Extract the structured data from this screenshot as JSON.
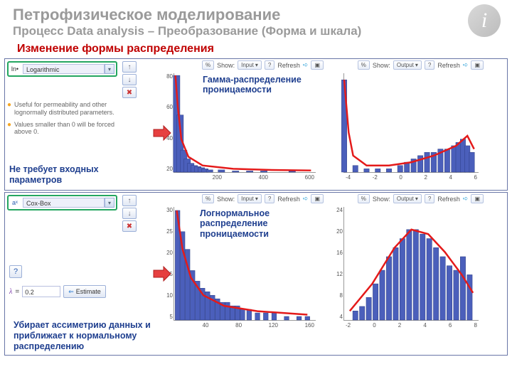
{
  "title": "Петрофизическое моделирование",
  "subtitle": "Процесс Data analysis – Преобразование (Форма и шкала)",
  "headline": "Изменение формы распределения",
  "logo_glyph": "i",
  "section1": {
    "dropdown_value": "Logarithmic",
    "bullets": [
      "Useful for permeability and other lognormally distributed parameters.",
      "Values smaller than 0 will be forced above 0."
    ],
    "caption": "Не требует входных параметров",
    "chart_annot": "Гамма-распределение проницаемости",
    "chart_in": {
      "toolbar_show": "Show:",
      "toolbar_sel": "Input",
      "refresh": "Refresh",
      "yticks": [
        "80",
        "60",
        "40",
        "20"
      ],
      "xticks": [
        "200",
        "400",
        "600"
      ]
    },
    "chart_out": {
      "toolbar_show": "Show:",
      "toolbar_sel": "Output",
      "refresh": "Refresh",
      "yticks": [
        "",
        "",
        "",
        ""
      ],
      "xticks": [
        "-4",
        "-2",
        "0",
        "2",
        "4",
        "6"
      ]
    }
  },
  "section2": {
    "dropdown_value": "Cox-Box",
    "lambda_label": "λ",
    "lambda_eq": "=",
    "lambda_val": "0.2",
    "estimate": "Estimate",
    "caption": "Убирает ассиметрию данных и приближает к нормальному распределению",
    "chart_annot": "Логнормальное распределение проницаемости",
    "chart_in": {
      "toolbar_show": "Show:",
      "toolbar_sel": "Input",
      "refresh": "Refresh",
      "yticks": [
        "30",
        "25",
        "20",
        "15",
        "10",
        "5"
      ],
      "xticks": [
        "40",
        "80",
        "120",
        "160"
      ]
    },
    "chart_out": {
      "toolbar_show": "Show:",
      "toolbar_sel": "Output",
      "refresh": "Refresh",
      "yticks": [
        "24",
        "20",
        "16",
        "12",
        "8",
        "4"
      ],
      "xticks": [
        "-2",
        "0",
        "2",
        "4",
        "6",
        "8"
      ]
    }
  },
  "chart_data": [
    {
      "type": "bar",
      "name": "gamma-input",
      "xlabel": "",
      "ylabel": "",
      "xlim": [
        0,
        600
      ],
      "ylim": [
        0,
        90
      ],
      "bars": [
        [
          10,
          88
        ],
        [
          25,
          52
        ],
        [
          40,
          20
        ],
        [
          55,
          12
        ],
        [
          70,
          8
        ],
        [
          85,
          6
        ],
        [
          100,
          5
        ],
        [
          115,
          4
        ],
        [
          130,
          3
        ],
        [
          150,
          2
        ],
        [
          200,
          2
        ],
        [
          260,
          1
        ],
        [
          320,
          1
        ],
        [
          380,
          1
        ],
        [
          500,
          1
        ]
      ],
      "curve": [
        [
          5,
          88
        ],
        [
          15,
          60
        ],
        [
          30,
          30
        ],
        [
          60,
          14
        ],
        [
          120,
          6
        ],
        [
          250,
          3
        ],
        [
          400,
          2
        ],
        [
          580,
          1.5
        ]
      ]
    },
    {
      "type": "bar",
      "name": "gamma-output",
      "xlabel": "",
      "ylabel": "",
      "xlim": [
        -5,
        7
      ],
      "ylim": [
        0,
        30
      ],
      "bars": [
        [
          -5,
          28
        ],
        [
          -4,
          2
        ],
        [
          -3,
          1
        ],
        [
          -2,
          1
        ],
        [
          -1,
          1
        ],
        [
          0,
          2
        ],
        [
          0.6,
          3
        ],
        [
          1.2,
          4
        ],
        [
          1.8,
          5
        ],
        [
          2.4,
          6
        ],
        [
          3.0,
          6
        ],
        [
          3.6,
          7
        ],
        [
          4.2,
          7
        ],
        [
          4.8,
          8
        ],
        [
          5.2,
          9
        ],
        [
          5.6,
          10
        ],
        [
          6.0,
          8
        ],
        [
          6.4,
          6
        ]
      ],
      "curve": [
        [
          -5,
          28
        ],
        [
          -4.6,
          12
        ],
        [
          -4.2,
          5
        ],
        [
          -3.0,
          2
        ],
        [
          -1.0,
          2
        ],
        [
          1.0,
          3
        ],
        [
          3.0,
          5
        ],
        [
          5.0,
          8
        ],
        [
          6.0,
          11
        ],
        [
          6.6,
          7
        ]
      ]
    },
    {
      "type": "bar",
      "name": "lognorm-input",
      "xlabel": "",
      "ylabel": "",
      "xlim": [
        0,
        170
      ],
      "ylim": [
        0,
        32
      ],
      "bars": [
        [
          4,
          31
        ],
        [
          10,
          25
        ],
        [
          16,
          20
        ],
        [
          22,
          14
        ],
        [
          28,
          11
        ],
        [
          34,
          9
        ],
        [
          40,
          8
        ],
        [
          46,
          7
        ],
        [
          52,
          6
        ],
        [
          58,
          5
        ],
        [
          64,
          5
        ],
        [
          70,
          4
        ],
        [
          76,
          4
        ],
        [
          82,
          3
        ],
        [
          90,
          3
        ],
        [
          100,
          2
        ],
        [
          110,
          2
        ],
        [
          120,
          2
        ],
        [
          135,
          1
        ],
        [
          150,
          1
        ],
        [
          160,
          1
        ]
      ],
      "curve": [
        [
          3,
          31
        ],
        [
          10,
          20
        ],
        [
          20,
          12
        ],
        [
          35,
          7
        ],
        [
          60,
          4
        ],
        [
          100,
          2.5
        ],
        [
          160,
          1.5
        ]
      ]
    },
    {
      "type": "bar",
      "name": "lognorm-output",
      "xlabel": "",
      "ylabel": "",
      "xlim": [
        -3,
        9
      ],
      "ylim": [
        0,
        25
      ],
      "bars": [
        [
          -2,
          2
        ],
        [
          -1.4,
          3
        ],
        [
          -0.8,
          5
        ],
        [
          -0.2,
          8
        ],
        [
          0.4,
          11
        ],
        [
          1.0,
          14
        ],
        [
          1.6,
          16
        ],
        [
          2.2,
          18
        ],
        [
          2.8,
          20
        ],
        [
          3.4,
          20
        ],
        [
          4.0,
          19
        ],
        [
          4.6,
          18
        ],
        [
          5.2,
          16
        ],
        [
          5.8,
          14
        ],
        [
          6.4,
          12
        ],
        [
          7.0,
          11
        ],
        [
          7.6,
          14
        ],
        [
          8.2,
          10
        ]
      ],
      "curve": [
        [
          -2.5,
          2
        ],
        [
          -0.5,
          8
        ],
        [
          1.5,
          16
        ],
        [
          3.0,
          20
        ],
        [
          4.5,
          19
        ],
        [
          6.0,
          15
        ],
        [
          7.5,
          10
        ],
        [
          8.5,
          6
        ]
      ]
    }
  ]
}
